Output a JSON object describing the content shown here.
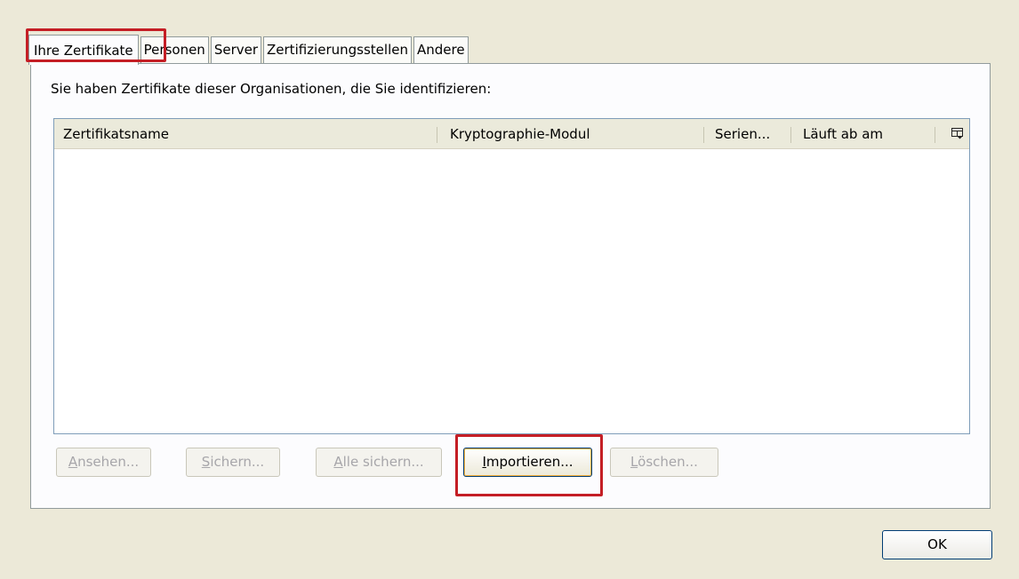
{
  "tabs": [
    {
      "label": "Ihre Zertifikate",
      "active": true
    },
    {
      "label": "Personen"
    },
    {
      "label": "Server"
    },
    {
      "label": "Zertifizierungsstellen"
    },
    {
      "label": "Andere"
    }
  ],
  "panel": {
    "intro_text": "Sie haben Zertifikate dieser Organisationen, die Sie identifizieren:"
  },
  "table": {
    "columns": [
      "Zertifikatsname",
      "Kryptographie-Modul",
      "Serien...",
      "Läuft ab am"
    ],
    "column_picker_icon": "column-picker-icon",
    "rows": []
  },
  "buttons": {
    "view": {
      "mnemonic": "A",
      "rest": "nsehen..."
    },
    "backup": {
      "mnemonic": "S",
      "rest": "ichern..."
    },
    "backup_all": {
      "mnemonic": "A",
      "rest": "lle sichern..."
    },
    "import": {
      "mnemonic": "I",
      "rest": "mportieren..."
    },
    "delete": {
      "mnemonic": "L",
      "rest": "öschen..."
    },
    "ok": "OK"
  },
  "colors": {
    "highlight": "#c41e25",
    "dialog_bg": "#ece9d8"
  }
}
